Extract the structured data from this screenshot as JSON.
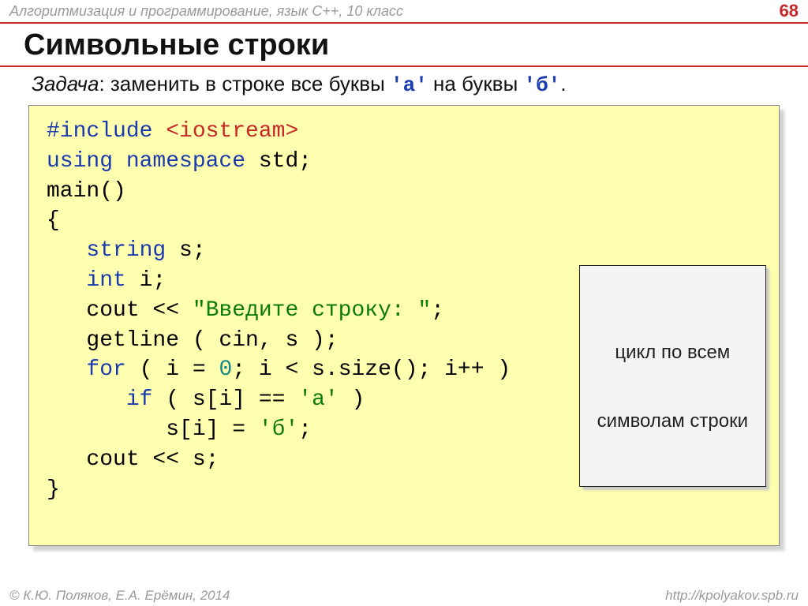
{
  "header": {
    "course": "Алгоритмизация и программирование, язык C++, 10 класс",
    "page": "68"
  },
  "title": "Символьные строки",
  "task": {
    "label": "Задача",
    "text_1": ": заменить в строке все буквы ",
    "a": "'а'",
    "text_2": " на буквы ",
    "b": "'б'",
    "text_3": "."
  },
  "code": {
    "l1a": "#include ",
    "l1b": "<iostream>",
    "l2a": "using namespace",
    "l2b": " std;",
    "l3": "main()",
    "l4": "{",
    "l5a": "   ",
    "l5b": "string",
    "l5c": " s;",
    "l6a": "   ",
    "l6b": "int",
    "l6c": " i;",
    "l7a": "   cout << ",
    "l7b": "\"Введите строку: \"",
    "l7c": ";",
    "l8": "   getline ( cin, s );",
    "l9a": "   ",
    "l9b": "for",
    "l9c": " ( i = ",
    "l9d": "0",
    "l9e": "; i < s.size(); i++ )",
    "l10a": "      ",
    "l10b": "if",
    "l10c": " ( s[i] == ",
    "l10d": "'а'",
    "l10e": " )",
    "l11a": "         s[i] = ",
    "l11b": "'б'",
    "l11c": ";",
    "l12": "   cout << s;",
    "l13": "}"
  },
  "callout": {
    "line1": "цикл по всем",
    "line2": "символам строки"
  },
  "footer": {
    "authors": "© К.Ю. Поляков, Е.А. Ерёмин, 2014",
    "url": "http://kpolyakov.spb.ru"
  }
}
